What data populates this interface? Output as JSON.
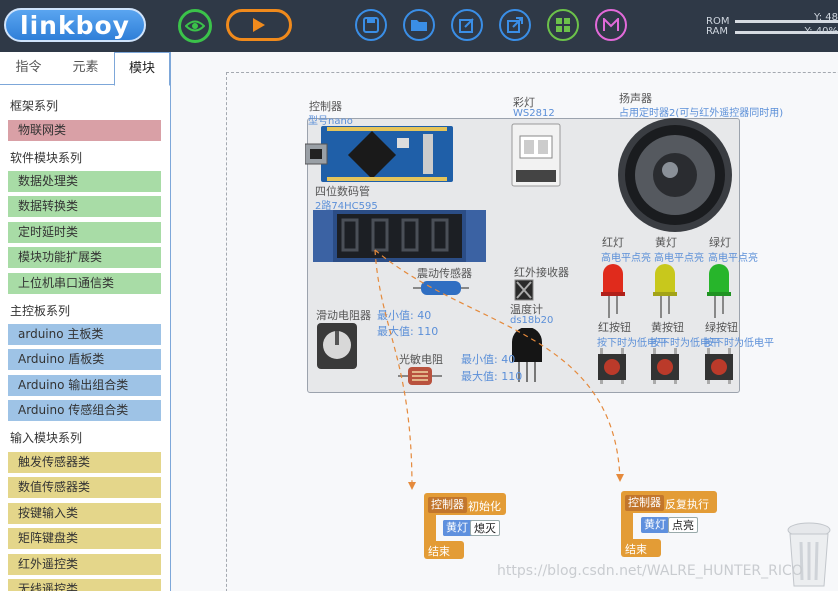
{
  "app": {
    "logo": "linkboy"
  },
  "toolbar": {
    "icons": [
      "eye-icon",
      "play-icon",
      "save-icon",
      "open-folder-icon",
      "edit-icon",
      "export-icon",
      "grid-icon",
      "mail-icon"
    ],
    "rom_label": "ROM",
    "ram_label": "RAM",
    "rom_value": "Y: 48",
    "ram_value": "Y: 40%"
  },
  "sidebar": {
    "tabs": [
      "指令",
      "元素",
      "模块"
    ],
    "active_tab": "模块",
    "sections": [
      {
        "title": "框架系列",
        "items": [
          {
            "label": "物联网类",
            "color": "red"
          }
        ]
      },
      {
        "title": "软件模块系列",
        "items": [
          {
            "label": "数据处理类",
            "color": "green"
          },
          {
            "label": "数据转换类",
            "color": "green"
          },
          {
            "label": "定时延时类",
            "color": "green"
          },
          {
            "label": "模块功能扩展类",
            "color": "green"
          },
          {
            "label": "上位机串口通信类",
            "color": "green"
          }
        ]
      },
      {
        "title": "主控板系列",
        "items": [
          {
            "label": "arduino 主板类",
            "color": "blue"
          },
          {
            "label": "Arduino 盾板类",
            "color": "blue"
          },
          {
            "label": "Arduino 输出组合类",
            "color": "blue"
          },
          {
            "label": "Arduino 传感组合类",
            "color": "blue"
          }
        ]
      },
      {
        "title": "输入模块系列",
        "items": [
          {
            "label": "触发传感器类",
            "color": "yellow"
          },
          {
            "label": "数值传感器类",
            "color": "yellow"
          },
          {
            "label": "按键输入类",
            "color": "yellow"
          },
          {
            "label": "矩阵键盘类",
            "color": "yellow"
          },
          {
            "label": "红外遥控类",
            "color": "yellow"
          },
          {
            "label": "无线遥控类",
            "color": "yellow"
          }
        ]
      }
    ]
  },
  "components": {
    "controller": {
      "name": "控制器",
      "sub": "型号nano"
    },
    "rgb": {
      "name": "彩灯",
      "sub": "WS2812"
    },
    "speaker": {
      "name": "扬声器",
      "sub": "占用定时器2(可与红外遥控器同时用)"
    },
    "display": {
      "name": "四位数码管",
      "sub": "2路74HC595"
    },
    "vibration": {
      "name": "震动传感器"
    },
    "ir_receiver": {
      "name": "红外接收器"
    },
    "thermometer": {
      "name": "温度计",
      "sub": "ds18b20"
    },
    "pot": {
      "name": "滑动电阻器",
      "min": "最小值: 40",
      "max": "最大值: 110"
    },
    "ldr": {
      "name": "光敏电阻",
      "min": "最小值: 40",
      "max": "最大值: 110"
    },
    "red_led": {
      "name": "红灯",
      "sub": "高电平点亮"
    },
    "yellow_led": {
      "name": "黄灯",
      "sub": "高电平点亮"
    },
    "green_led": {
      "name": "绿灯",
      "sub": "高电平点亮"
    },
    "red_btn": {
      "name": "红按钮",
      "sub": "按下时为低电平"
    },
    "yellow_btn": {
      "name": "黄按钮",
      "sub": "按下时为低电平"
    },
    "green_btn": {
      "name": "绿按钮",
      "sub": "按下时为低电平"
    }
  },
  "blocks": {
    "init": {
      "owner": "控制器",
      "event": "初始化",
      "target": "黄灯",
      "action": "熄灭",
      "end": "结束"
    },
    "loop": {
      "owner": "控制器",
      "event": "反复执行",
      "target": "黄灯",
      "action": "点亮",
      "end": "结束"
    }
  },
  "watermark": "https://blog.csdn.net/WALRE_HUNTER_RICO"
}
